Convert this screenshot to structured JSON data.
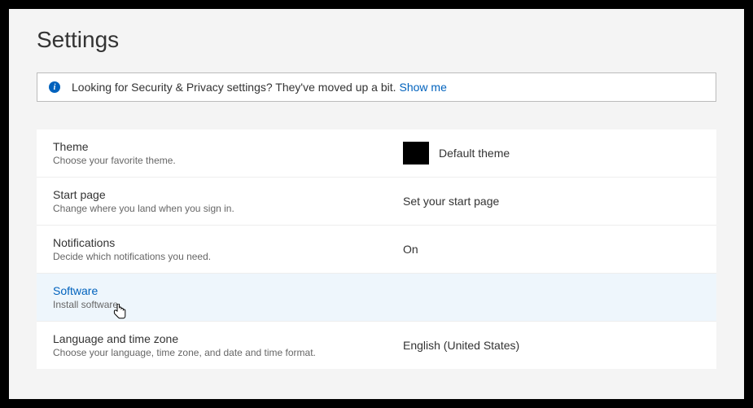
{
  "page_title": "Settings",
  "banner": {
    "text": "Looking for Security & Privacy settings? They've moved up a bit.",
    "link_text": "Show me"
  },
  "rows": {
    "theme": {
      "title": "Theme",
      "desc": "Choose your favorite theme.",
      "value": "Default theme"
    },
    "startpage": {
      "title": "Start page",
      "desc": "Change where you land when you sign in.",
      "value": "Set your start page"
    },
    "notifications": {
      "title": "Notifications",
      "desc": "Decide which notifications you need.",
      "value": "On"
    },
    "software": {
      "title": "Software",
      "desc": "Install software."
    },
    "language": {
      "title": "Language and time zone",
      "desc": "Choose your language, time zone, and date and time format.",
      "value": "English (United States)"
    }
  }
}
